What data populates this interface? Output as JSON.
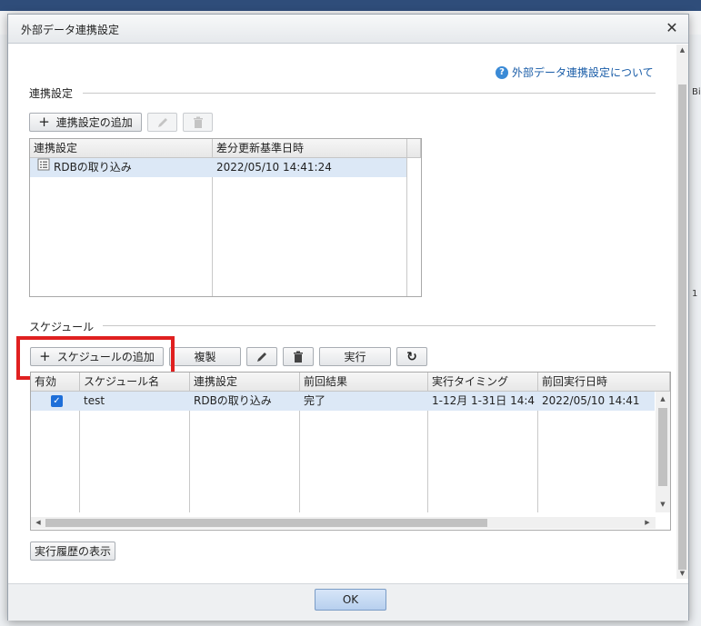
{
  "dialog": {
    "title": "外部データ連携設定",
    "close_glyph": "✕",
    "help_link": "外部データ連携設定について",
    "help_icon_glyph": "?"
  },
  "background": {
    "right_text_1": "Bil",
    "right_text_2": "1"
  },
  "integration": {
    "section_title": "連携設定",
    "add_button": "連携設定の追加",
    "columns": [
      "連携設定",
      "差分更新基準日時"
    ],
    "rows": [
      {
        "name": "RDBの取り込み",
        "updated": "2022/05/10 14:41:24"
      }
    ]
  },
  "schedule": {
    "section_title": "スケジュール",
    "add_button": "スケジュールの追加",
    "copy_button": "複製",
    "run_button": "実行",
    "refresh_glyph": "↻",
    "columns": [
      "有効",
      "スケジュール名",
      "連携設定",
      "前回結果",
      "実行タイミング",
      "前回実行日時"
    ],
    "rows": [
      {
        "enabled": true,
        "name": "test",
        "integration": "RDBの取り込み",
        "result": "完了",
        "timing": "1-12月 1-31日 14:4",
        "last_run": "2022/05/10 14:41"
      }
    ]
  },
  "history_button": "実行履歴の表示",
  "ok_button": "OK",
  "icons": {
    "plus": "+",
    "check": "✓",
    "arrow_up": "▲",
    "arrow_down": "▼",
    "arrow_left": "◀",
    "arrow_right": "▶"
  },
  "colors": {
    "accent": "#1e6fd9",
    "selected_row": "#dce8f6",
    "highlight_box": "#e02020",
    "link": "#1a5da8"
  }
}
